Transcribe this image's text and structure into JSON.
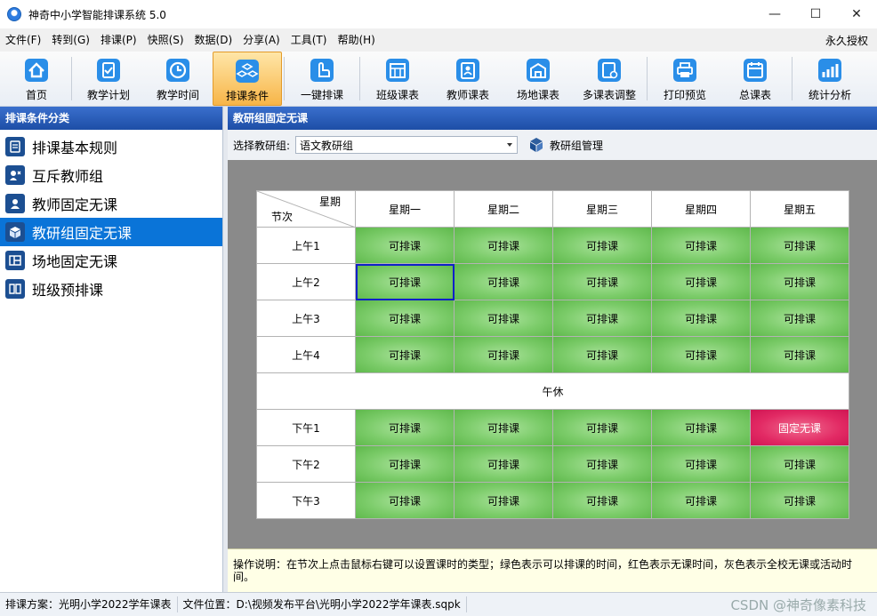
{
  "window": {
    "title": "神奇中小学智能排课系统 5.0",
    "minimize": "—",
    "maximize": "☐",
    "close": "✕"
  },
  "menu": {
    "items": [
      "文件(F)",
      "转到(G)",
      "排课(P)",
      "快照(S)",
      "数据(D)",
      "分享(A)",
      "工具(T)",
      "帮助(H)"
    ],
    "license": "永久授权"
  },
  "toolbar": {
    "buttons": [
      {
        "label": "首页",
        "icon": "home-icon",
        "color": "#2a8ee8"
      },
      {
        "label": "教学计划",
        "icon": "clipboard-check-icon",
        "color": "#2a8ee8"
      },
      {
        "label": "教学时间",
        "icon": "clock-icon",
        "color": "#2a8ee8"
      },
      {
        "label": "排课条件",
        "icon": "cubes-icon",
        "color": "#2a8ee8"
      },
      {
        "label": "一键排课",
        "icon": "pointer-hand-icon",
        "color": "#2a8ee8"
      },
      {
        "label": "班级课表",
        "icon": "calendar-grid-icon",
        "color": "#2a8ee8"
      },
      {
        "label": "教师课表",
        "icon": "teacher-id-icon",
        "color": "#2a8ee8"
      },
      {
        "label": "场地课表",
        "icon": "building-icon",
        "color": "#2a8ee8"
      },
      {
        "label": "多课表调整",
        "icon": "multi-schedule-icon",
        "color": "#2a8ee8"
      },
      {
        "label": "打印预览",
        "icon": "printer-icon",
        "color": "#2a8ee8"
      },
      {
        "label": "总课表",
        "icon": "master-calendar-icon",
        "color": "#2a8ee8"
      },
      {
        "label": "统计分析",
        "icon": "bar-chart-icon",
        "color": "#2a8ee8"
      }
    ],
    "active_index": 3
  },
  "left_panel": {
    "title": "排课条件分类",
    "items": [
      {
        "label": "排课基本规则",
        "icon": "rules-icon"
      },
      {
        "label": "互斥教师组",
        "icon": "mutex-teacher-icon"
      },
      {
        "label": "教师固定无课",
        "icon": "teacher-icon"
      },
      {
        "label": "教研组固定无课",
        "icon": "cube-icon"
      },
      {
        "label": "场地固定无课",
        "icon": "venue-icon"
      },
      {
        "label": "班级预排课",
        "icon": "book-icon"
      }
    ],
    "selected_index": 3
  },
  "right_panel": {
    "title": "教研组固定无课",
    "select_label": "选择教研组:",
    "select_value": "语文教研组",
    "manage_button": "教研组管理"
  },
  "schedule": {
    "corner_top": "星期",
    "corner_bottom": "节次",
    "days": [
      "星期一",
      "星期二",
      "星期三",
      "星期四",
      "星期五"
    ],
    "lunch_label": "午休",
    "morning_rows": [
      {
        "label": "上午1",
        "cells": [
          "可排课",
          "可排课",
          "可排课",
          "可排课",
          "可排课"
        ]
      },
      {
        "label": "上午2",
        "cells": [
          "可排课",
          "可排课",
          "可排课",
          "可排课",
          "可排课"
        ]
      },
      {
        "label": "上午3",
        "cells": [
          "可排课",
          "可排课",
          "可排课",
          "可排课",
          "可排课"
        ]
      },
      {
        "label": "上午4",
        "cells": [
          "可排课",
          "可排课",
          "可排课",
          "可排课",
          "可排课"
        ]
      }
    ],
    "afternoon_rows": [
      {
        "label": "下午1",
        "cells": [
          "可排课",
          "可排课",
          "可排课",
          "可排课",
          "固定无课"
        ]
      },
      {
        "label": "下午2",
        "cells": [
          "可排课",
          "可排课",
          "可排课",
          "可排课",
          "可排课"
        ]
      },
      {
        "label": "下午3",
        "cells": [
          "可排课",
          "可排课",
          "可排课",
          "可排课",
          "可排课"
        ]
      }
    ],
    "available_color": "#7ccc6a",
    "blocked_color": "#e22a64"
  },
  "instructions": "操作说明：在节次上点击鼠标右键可以设置课时的类型；绿色表示可以排课的时间，红色表示无课时间，灰色表示全校无课或活动时间。",
  "status": {
    "plan": "排课方案：光明小学2022学年课表",
    "file": "文件位置：D:\\视频发布平台\\光明小学2022学年课表.sqpk",
    "watermark": "CSDN @神奇像素科技"
  }
}
